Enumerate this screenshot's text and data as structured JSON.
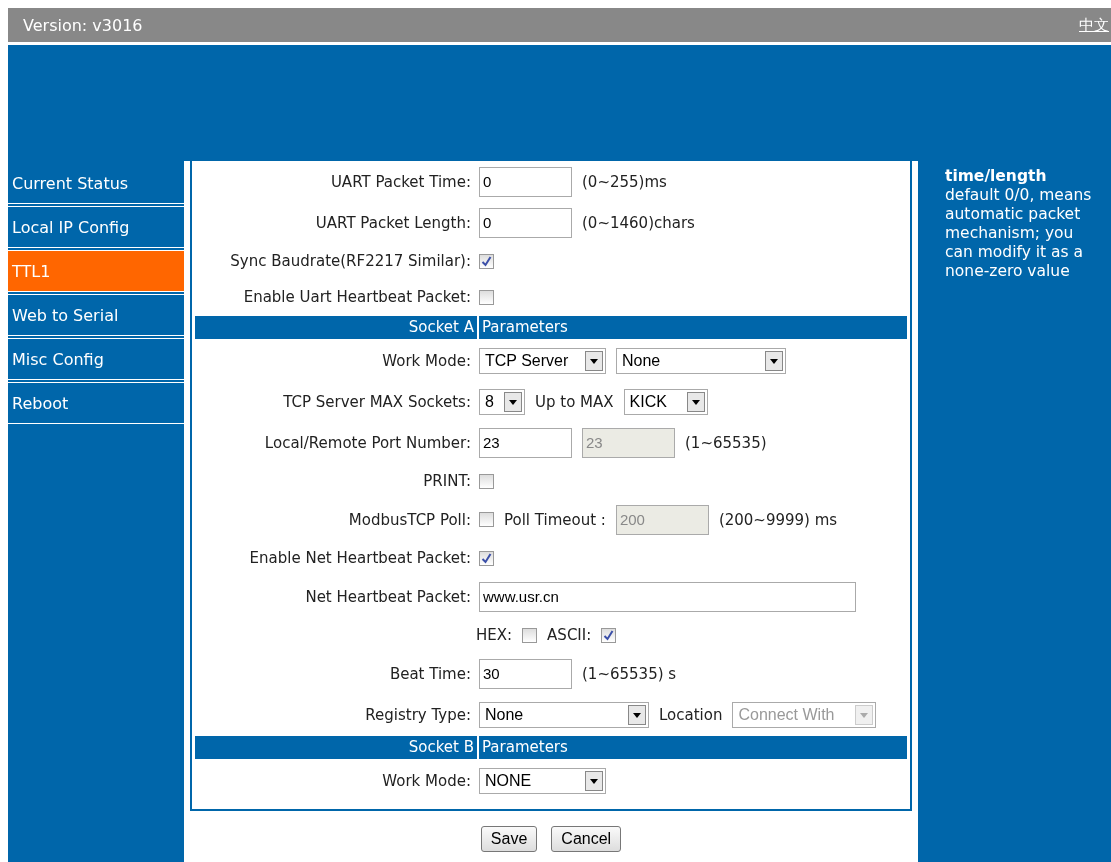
{
  "version_bar": {
    "version": "Version: v3016",
    "language_link": "中文"
  },
  "sidebar": {
    "items": [
      {
        "label": "Current Status",
        "selected": false
      },
      {
        "label": "Local IP Config",
        "selected": false
      },
      {
        "label": "TTL1",
        "selected": true
      },
      {
        "label": "Web to Serial",
        "selected": false
      },
      {
        "label": "Misc Config",
        "selected": false
      },
      {
        "label": "Reboot",
        "selected": false
      }
    ]
  },
  "form": {
    "rows": [
      {
        "kind": "field",
        "label": "UART Packet Time:",
        "controls": [
          {
            "kind": "input",
            "value": "0"
          },
          {
            "kind": "text",
            "text": "(0~255)ms"
          }
        ]
      },
      {
        "kind": "field",
        "label": "UART Packet Length:",
        "controls": [
          {
            "kind": "input",
            "value": "0"
          },
          {
            "kind": "text",
            "text": "(0~1460)chars"
          }
        ]
      },
      {
        "kind": "check",
        "label": "Sync Baudrate(RF2217 Similar):",
        "controls": [
          {
            "kind": "checkbox",
            "checked": true
          }
        ]
      },
      {
        "kind": "check",
        "label": "Enable Uart Heartbeat Packet:",
        "controls": [
          {
            "kind": "checkbox",
            "checked": false
          }
        ]
      },
      {
        "kind": "section",
        "label": "Socket A",
        "title": "Parameters"
      },
      {
        "kind": "field",
        "label": "Work Mode:",
        "controls": [
          {
            "kind": "select-m",
            "value": "TCP Server",
            "disabled": false
          },
          {
            "kind": "select-l",
            "value": "None",
            "disabled": false
          }
        ]
      },
      {
        "kind": "field",
        "label": "TCP Server MAX Sockets:",
        "controls": [
          {
            "kind": "select-xs",
            "value": "8",
            "disabled": false
          },
          {
            "kind": "text",
            "text": "Up to MAX"
          },
          {
            "kind": "select-s",
            "value": "KICK",
            "disabled": false
          }
        ]
      },
      {
        "kind": "field",
        "label": "Local/Remote Port Number:",
        "controls": [
          {
            "kind": "input",
            "value": "23",
            "disabled": false
          },
          {
            "kind": "input",
            "value": "23",
            "disabled": true
          },
          {
            "kind": "text",
            "text": "(1~65535)"
          }
        ]
      },
      {
        "kind": "check",
        "label": "PRINT:",
        "controls": [
          {
            "kind": "checkbox",
            "checked": false
          }
        ]
      },
      {
        "kind": "field",
        "label": "ModbusTCP Poll:",
        "controls": [
          {
            "kind": "checkbox",
            "checked": false
          },
          {
            "kind": "text",
            "text": "Poll Timeout :"
          },
          {
            "kind": "input",
            "value": "200",
            "disabled": true
          },
          {
            "kind": "text",
            "text": "(200~9999) ms"
          }
        ]
      },
      {
        "kind": "check",
        "label": "Enable Net Heartbeat Packet:",
        "controls": [
          {
            "kind": "checkbox",
            "checked": true
          }
        ]
      },
      {
        "kind": "field",
        "label": "Net Heartbeat Packet:",
        "controls": [
          {
            "kind": "input-long",
            "value": "www.usr.cn",
            "disabled": false
          }
        ]
      },
      {
        "kind": "inline",
        "controls": [
          {
            "kind": "text",
            "text": "HEX:"
          },
          {
            "kind": "checkbox",
            "checked": false
          },
          {
            "kind": "text",
            "text": "ASCII:"
          },
          {
            "kind": "checkbox",
            "checked": true
          }
        ]
      },
      {
        "kind": "field",
        "label": "Beat Time:",
        "controls": [
          {
            "kind": "input",
            "value": "30",
            "disabled": false
          },
          {
            "kind": "text",
            "text": "(1~65535) s"
          }
        ]
      },
      {
        "kind": "field",
        "label": "Registry Type:",
        "controls": [
          {
            "kind": "select-l",
            "value": "None",
            "disabled": false
          },
          {
            "kind": "text",
            "text": "Location"
          },
          {
            "kind": "select-m",
            "value": "Connect With",
            "disabled": true
          }
        ]
      },
      {
        "kind": "section",
        "label": "Socket B",
        "title": "Parameters"
      },
      {
        "kind": "field",
        "label": "Work Mode:",
        "controls": [
          {
            "kind": "select-m",
            "value": "NONE",
            "disabled": false
          }
        ]
      }
    ]
  },
  "buttons": [
    "Save",
    "Cancel"
  ],
  "help": {
    "text": "**time/length** default 0/0, means automatic packet mechanism; you can modify it as a none-zero value"
  }
}
